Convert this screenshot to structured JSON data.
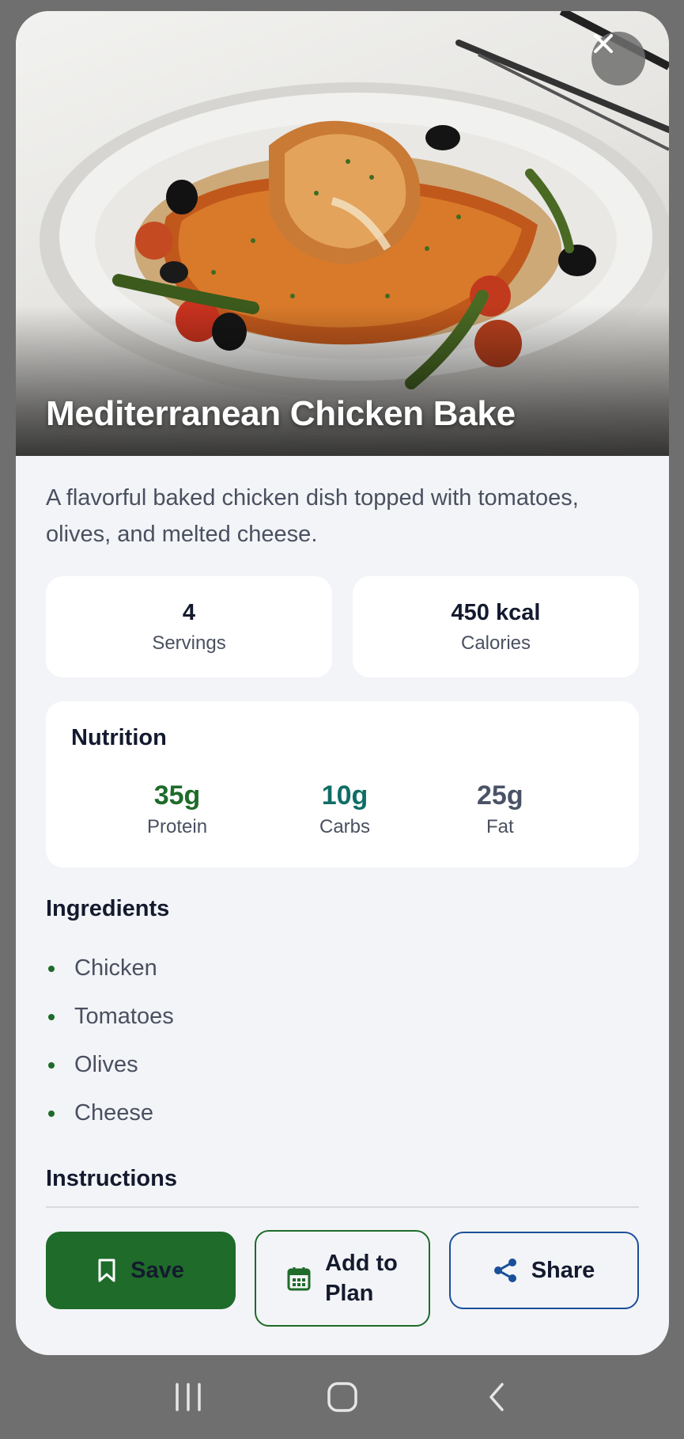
{
  "recipe": {
    "title": "Mediterranean Chicken Bake",
    "description": "A flavorful baked chicken dish topped with tomatoes, olives, and melted cheese.",
    "stats": [
      {
        "value": "4",
        "label": "Servings"
      },
      {
        "value": "450 kcal",
        "label": "Calories"
      }
    ]
  },
  "nutrition": {
    "title": "Nutrition",
    "macros": [
      {
        "value": "35g",
        "label": "Protein",
        "color": "#1e6b2a"
      },
      {
        "value": "10g",
        "label": "Carbs",
        "color": "#0f6e66"
      },
      {
        "value": "25g",
        "label": "Fat",
        "color": "#4a5366"
      }
    ]
  },
  "ingredients": {
    "title": "Ingredients",
    "items": [
      "Chicken",
      "Tomatoes",
      "Olives",
      "Cheese"
    ]
  },
  "instructions": {
    "title": "Instructions"
  },
  "actions": {
    "save_label": "Save",
    "plan_label_line1": "Add to",
    "plan_label_line2": "Plan",
    "share_label": "Share"
  },
  "icons": {
    "close": "close-icon",
    "save": "bookmark-icon",
    "plan": "calendar-icon",
    "share": "share-icon",
    "nav_recents": "recents-icon",
    "nav_home": "home-icon",
    "nav_back": "back-icon"
  },
  "colors": {
    "primary_green": "#1e6b2a",
    "share_blue": "#1a4f99",
    "text_dark": "#141a2e",
    "text_muted": "#4a5060",
    "background": "#f3f4f7"
  }
}
